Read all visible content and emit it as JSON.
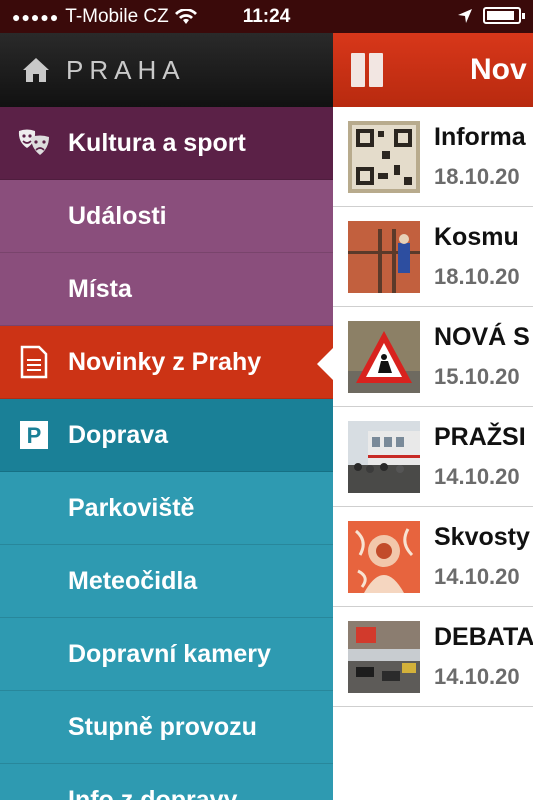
{
  "status": {
    "carrier": "T-Mobile CZ",
    "time": "11:24",
    "signal_dots": "●●●●●",
    "battery_level": 0.9
  },
  "sidebar": {
    "brand": "PRAHA",
    "items": [
      {
        "label": "Kultura a sport",
        "icon": "theater-masks-icon"
      },
      {
        "label": "Události"
      },
      {
        "label": "Místa"
      },
      {
        "label": "Novinky z Prahy",
        "icon": "newspaper-icon"
      },
      {
        "label": "Doprava",
        "icon": "parking-icon"
      },
      {
        "label": "Parkoviště"
      },
      {
        "label": "Meteočidla"
      },
      {
        "label": "Dopravní kamery"
      },
      {
        "label": "Stupně provozu"
      },
      {
        "label": "Info z dopravy"
      }
    ]
  },
  "main": {
    "title": "Nov",
    "news": [
      {
        "title": "Informa",
        "date": "18.10.20"
      },
      {
        "title": "Kosmu",
        "date": "18.10.20"
      },
      {
        "title": "NOVÁ S",
        "date": "15.10.20"
      },
      {
        "title": "PRAŽSI",
        "date": "14.10.20"
      },
      {
        "title": "Skvosty",
        "date": "14.10.20"
      },
      {
        "title": "DEBATA",
        "date": "14.10.20"
      }
    ]
  },
  "colors": {
    "culture": "#5b2147",
    "culture_sub": "#8a4e7c",
    "news": "#cc3315",
    "transport": "#1a8097",
    "transport_sub": "#2e9ab1"
  }
}
